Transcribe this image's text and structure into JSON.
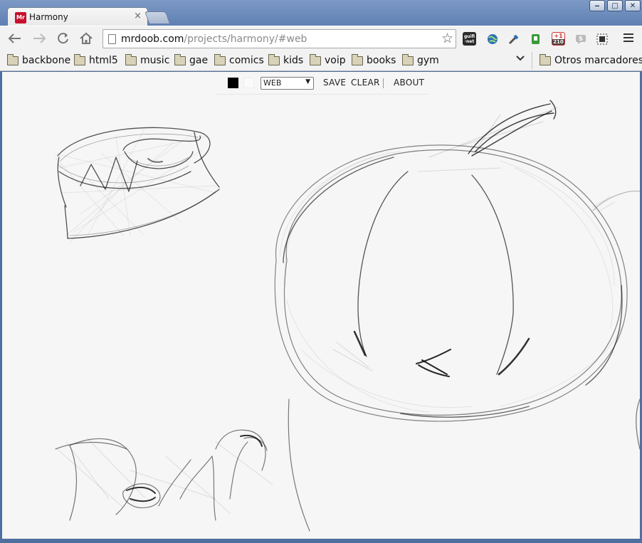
{
  "window": {
    "tab_title": "Harmony",
    "tab_favicon_text": "Mr",
    "tab_close_symbol": "×",
    "controls": {
      "minimize": "‒",
      "maximize": "□",
      "close": "✕"
    }
  },
  "toolbar": {
    "url_host": "mrdoob.com",
    "url_path": "/projects/harmony/#web",
    "extensions": [
      "guifi-net-icon",
      "globe-icon",
      "dropper-icon",
      "evernote-green-icon",
      "google-plus-one-icon",
      "instapaper-icon",
      "clip-icon"
    ],
    "guifi_label": "guifi\n·net",
    "plus_one_label": "+1",
    "plus_one_count": "210"
  },
  "bookmarks": {
    "items": [
      {
        "label": "backbone"
      },
      {
        "label": "html5"
      },
      {
        "label": "music"
      },
      {
        "label": "gae"
      },
      {
        "label": "comics"
      },
      {
        "label": "kids"
      },
      {
        "label": "voip"
      },
      {
        "label": "books"
      },
      {
        "label": "gym"
      }
    ],
    "other": "Otros marcadores"
  },
  "harmony": {
    "foreground_color": "#000000",
    "background_color": "#fafafa",
    "brush": "WEB",
    "save": "SAVE",
    "clear": "CLEAR",
    "about": "ABOUT"
  }
}
